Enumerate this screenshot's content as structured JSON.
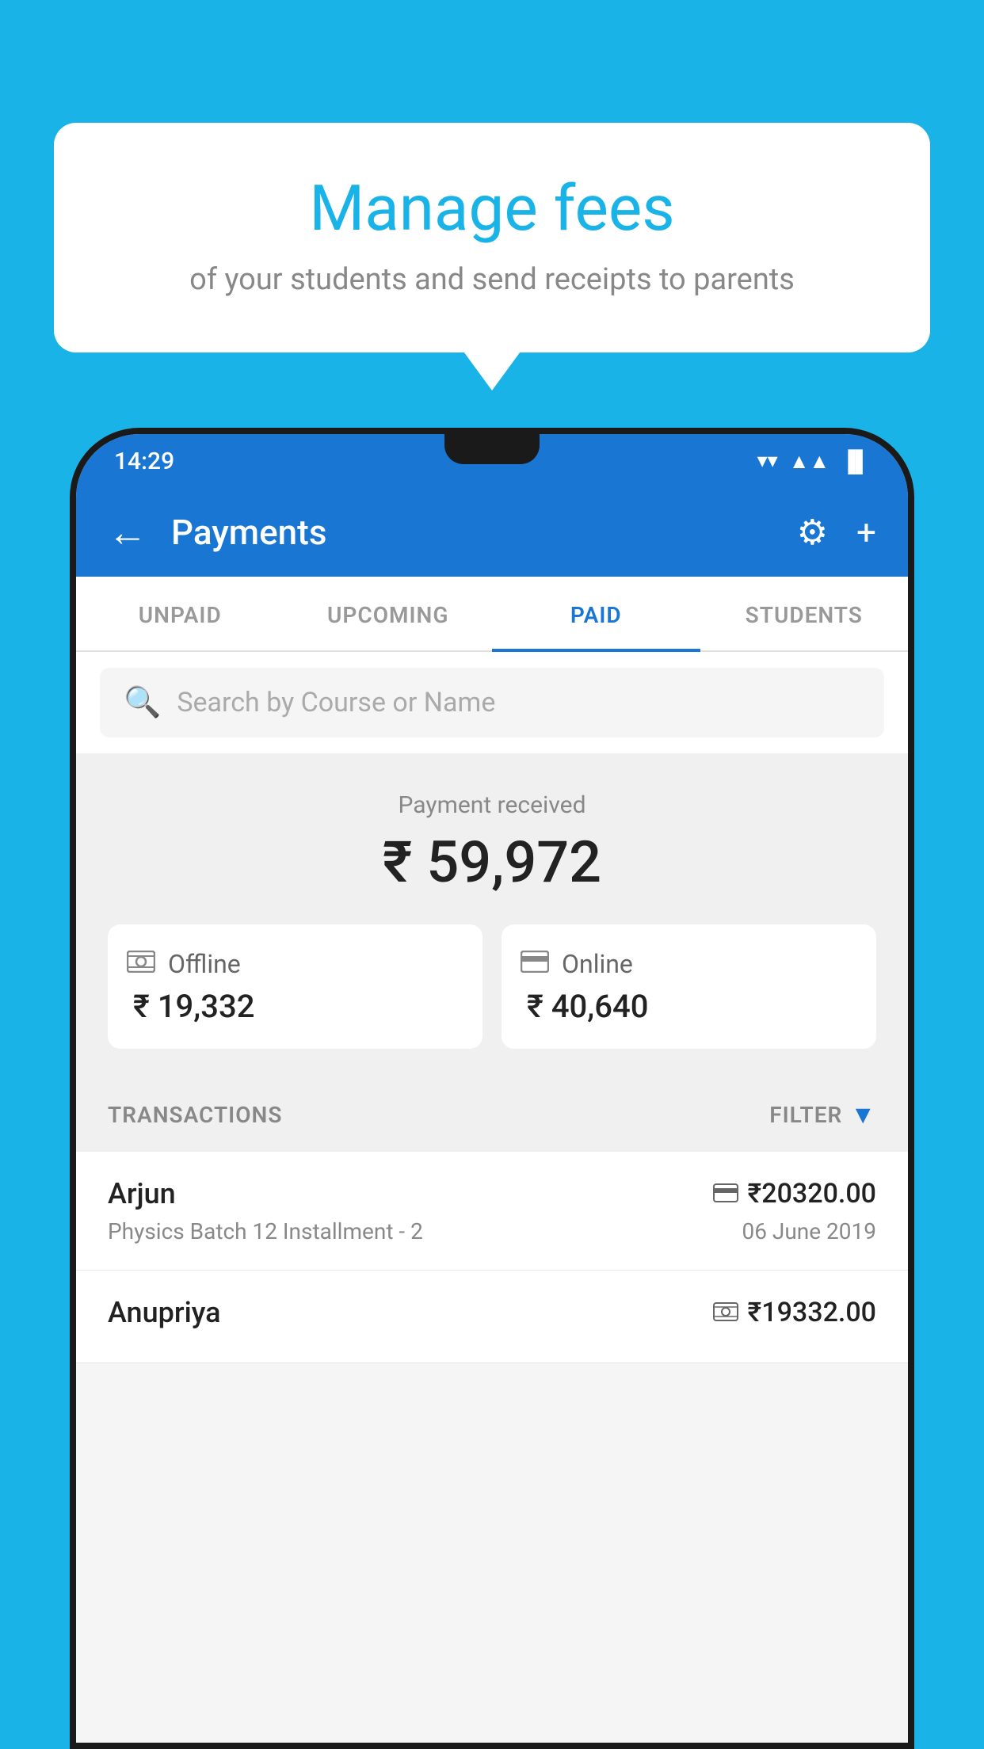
{
  "background_color": "#1ab3e8",
  "bubble": {
    "title": "Manage fees",
    "subtitle": "of your students and send receipts to parents"
  },
  "status_bar": {
    "time": "14:29",
    "wifi_icon": "▾",
    "signal_icon": "◀",
    "battery_icon": "▐"
  },
  "app_bar": {
    "back_icon": "←",
    "title": "Payments",
    "settings_icon": "⚙",
    "add_icon": "+"
  },
  "tabs": [
    {
      "id": "unpaid",
      "label": "UNPAID",
      "active": false
    },
    {
      "id": "upcoming",
      "label": "UPCOMING",
      "active": false
    },
    {
      "id": "paid",
      "label": "PAID",
      "active": true
    },
    {
      "id": "students",
      "label": "STUDENTS",
      "active": false
    }
  ],
  "search": {
    "placeholder": "Search by Course or Name"
  },
  "summary": {
    "label": "Payment received",
    "amount": "₹ 59,972",
    "offline": {
      "icon": "💳",
      "label": "Offline",
      "amount": "₹ 19,332"
    },
    "online": {
      "icon": "💳",
      "label": "Online",
      "amount": "₹ 40,640"
    }
  },
  "transactions": {
    "header_label": "TRANSACTIONS",
    "filter_label": "FILTER",
    "items": [
      {
        "name": "Arjun",
        "amount": "₹20320.00",
        "course": "Physics Batch 12 Installment - 2",
        "date": "06 June 2019",
        "payment_type": "card"
      },
      {
        "name": "Anupriya",
        "amount": "₹19332.00",
        "course": "",
        "date": "",
        "payment_type": "cash"
      }
    ]
  }
}
